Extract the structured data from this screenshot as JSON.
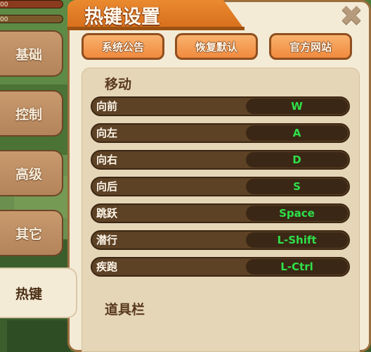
{
  "hud": {
    "bar1_text": "00",
    "bar2_text": "00"
  },
  "sidebar": {
    "items": [
      {
        "label": "基础"
      },
      {
        "label": "控制"
      },
      {
        "label": "高级"
      },
      {
        "label": "其它"
      },
      {
        "label": "热键",
        "active": true
      }
    ]
  },
  "header": {
    "title": "热键设置",
    "close_icon": "close-icon"
  },
  "toolbar": {
    "announcement_label": "系统公告",
    "restore_default_label": "恢复默认",
    "official_site_label": "官方网站"
  },
  "sections": [
    {
      "title": "移动",
      "rows": [
        {
          "action": "向前",
          "key": "W"
        },
        {
          "action": "向左",
          "key": "A"
        },
        {
          "action": "向右",
          "key": "D"
        },
        {
          "action": "向后",
          "key": "S"
        },
        {
          "action": "跳跃",
          "key": "Space"
        },
        {
          "action": "潜行",
          "key": "L-Shift"
        },
        {
          "action": "疾跑",
          "key": "L-Ctrl"
        }
      ]
    },
    {
      "title": "道具栏"
    }
  ],
  "colors": {
    "accent_orange": "#f08a3e",
    "panel_bg": "#f4ebd6",
    "key_text_green": "#2ee04a",
    "row_bg": "#5e4226"
  }
}
